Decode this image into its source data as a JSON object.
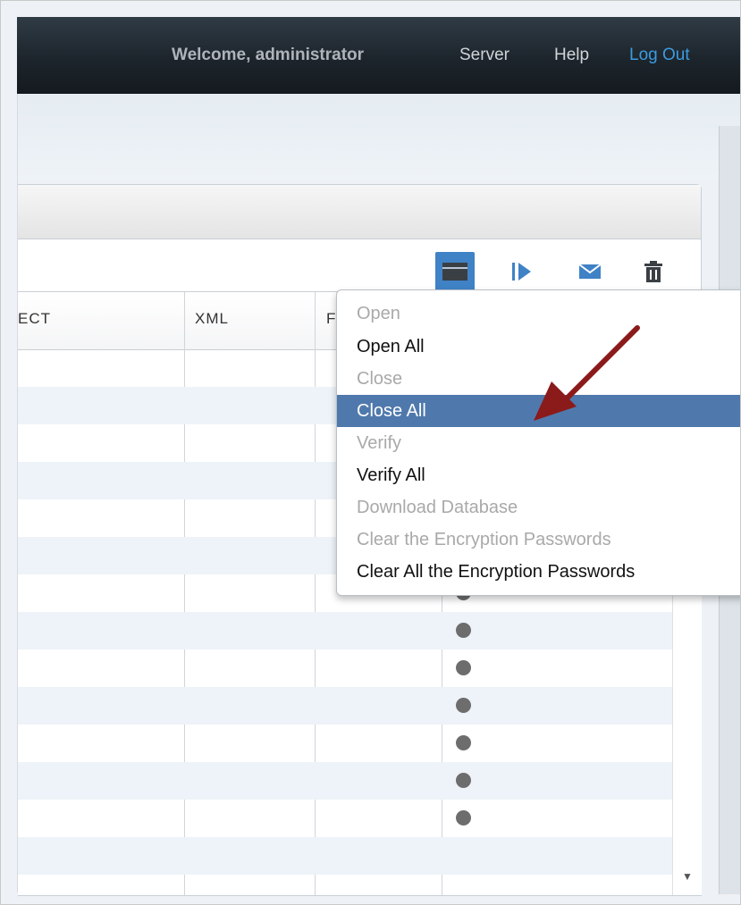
{
  "header": {
    "welcome": "Welcome, administrator",
    "nav": {
      "server": "Server",
      "help": "Help",
      "logout": "Log Out"
    }
  },
  "toolbar": {
    "icons": [
      "folder-icon",
      "play-icon",
      "mail-icon",
      "trash-icon"
    ],
    "accent": "#3f82c6"
  },
  "table": {
    "columns": [
      "ECT",
      "XML",
      "F"
    ],
    "status_dot_color": "#6d6d6d"
  },
  "menu": {
    "items": [
      {
        "label": "Open",
        "enabled": false,
        "selected": false
      },
      {
        "label": "Open All",
        "enabled": true,
        "selected": false
      },
      {
        "label": "Close",
        "enabled": false,
        "selected": false
      },
      {
        "label": "Close All",
        "enabled": true,
        "selected": true
      },
      {
        "label": "Verify",
        "enabled": false,
        "selected": false
      },
      {
        "label": "Verify All",
        "enabled": true,
        "selected": false
      },
      {
        "label": "Download Database",
        "enabled": false,
        "selected": false
      },
      {
        "label": "Clear the Encryption Passwords",
        "enabled": false,
        "selected": false
      },
      {
        "label": "Clear All the Encryption Passwords",
        "enabled": true,
        "selected": false
      }
    ],
    "selected_color": "#4f79ac"
  },
  "annotation": {
    "arrow_color": "#8b1a1a"
  }
}
